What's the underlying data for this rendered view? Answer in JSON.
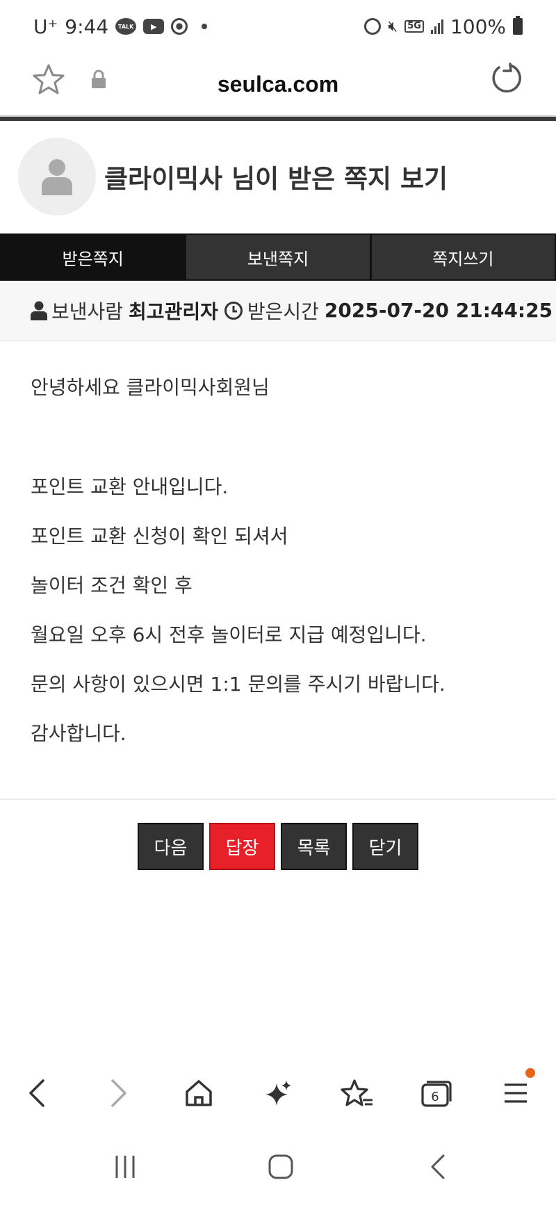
{
  "status_bar": {
    "carrier": "U⁺",
    "time": "9:44",
    "talk_badge": "TALK",
    "network": "5G",
    "battery": "100%"
  },
  "browser": {
    "url": "seulca.com",
    "tab_count": "6"
  },
  "page": {
    "title": "클라이믹사 님이 받은 쪽지 보기"
  },
  "tabs": [
    {
      "label": "받은쪽지",
      "active": true
    },
    {
      "label": "보낸쪽지",
      "active": false
    },
    {
      "label": "쪽지쓰기",
      "active": false
    }
  ],
  "meta": {
    "sender_label": "보낸사람",
    "sender": "최고관리자",
    "time_label": "받은시간",
    "time": "2025-07-20 21:44:25"
  },
  "message": {
    "lines": [
      "안녕하세요 클라이믹사회원님",
      "포인트 교환 안내입니다.",
      "포인트 교환 신청이 확인 되셔서",
      "놀이터 조건 확인 후",
      "월요일 오후 6시 전후 놀이터로 지급 예정입니다.",
      "문의 사항이 있으시면 1:1 문의를 주시기 바랍니다.",
      "감사합니다."
    ]
  },
  "actions": {
    "next": "다음",
    "reply": "답장",
    "list": "목록",
    "close": "닫기"
  },
  "colors": {
    "reply_button": "#e8202a",
    "tab_active": "#111111",
    "tab_inactive": "#333333",
    "notification_dot": "#e8641b"
  },
  "icons": {
    "browser_nav": [
      "back-icon",
      "forward-icon",
      "home-icon",
      "sparkle-icon",
      "bookmarks-icon",
      "tabs-icon",
      "menu-icon"
    ],
    "system_nav": [
      "recent-apps-icon",
      "home-circle-icon",
      "back-chevron-icon"
    ]
  }
}
